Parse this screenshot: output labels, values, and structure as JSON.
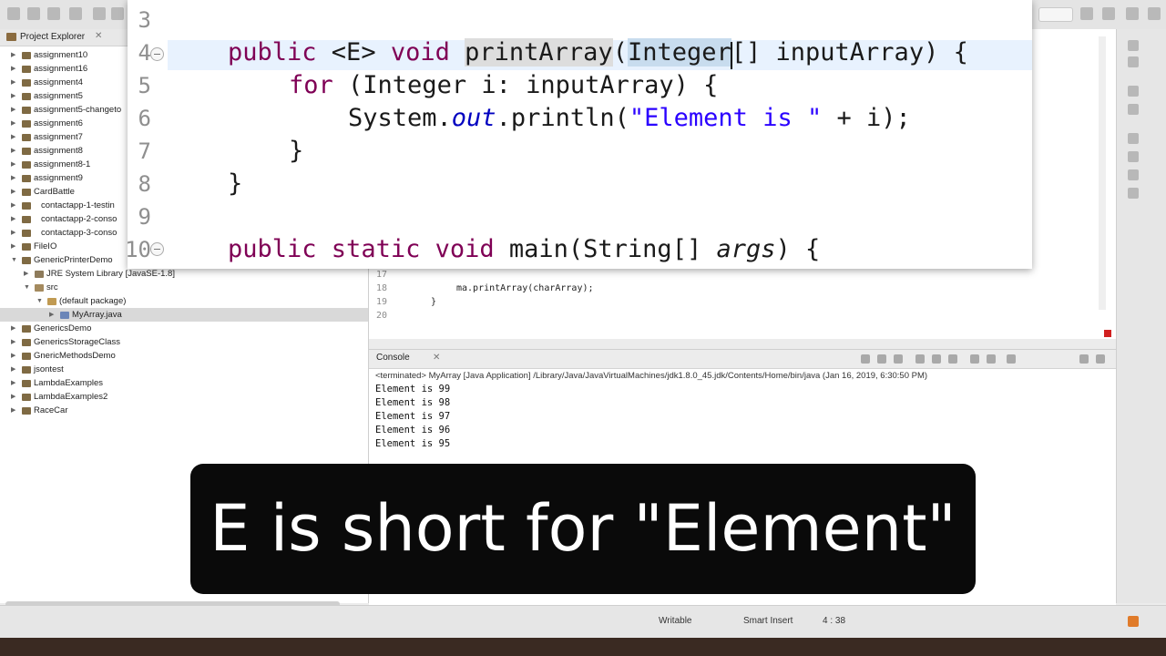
{
  "explorer": {
    "title": "Project Explorer",
    "close": "✕",
    "items": [
      {
        "label": "assignment10"
      },
      {
        "label": "assignment16"
      },
      {
        "label": "assignment4"
      },
      {
        "label": "assignment5"
      },
      {
        "label": "assignment5-changeto"
      },
      {
        "label": "assignment6"
      },
      {
        "label": "assignment7"
      },
      {
        "label": "assignment8"
      },
      {
        "label": "assignment8-1"
      },
      {
        "label": "assignment9"
      },
      {
        "label": "CardBattle"
      },
      {
        "label": "contactapp-1-testin"
      },
      {
        "label": "contactapp-2-conso"
      },
      {
        "label": "contactapp-3-conso"
      },
      {
        "label": "FileIO"
      },
      {
        "label": "GenericPrinterDemo"
      },
      {
        "label": "JRE System Library [JavaSE-1.8]"
      },
      {
        "label": "src"
      },
      {
        "label": "(default package)"
      },
      {
        "label": "MyArray.java"
      },
      {
        "label": "GenericsDemo"
      },
      {
        "label": "GenericsStorageClass"
      },
      {
        "label": "GnericMethodsDemo"
      },
      {
        "label": "jsontest"
      },
      {
        "label": "LambdaExamples"
      },
      {
        "label": "LambdaExamples2"
      },
      {
        "label": "RaceCar"
      }
    ]
  },
  "editor": {
    "lines": [
      {
        "num": "17",
        "code": ""
      },
      {
        "num": "18",
        "code": "ma.printArray(charArray);"
      },
      {
        "num": "19",
        "code": "}"
      },
      {
        "num": "20",
        "code": ""
      }
    ]
  },
  "zoom": {
    "line_numbers": [
      "3",
      "4",
      "5",
      "6",
      "7",
      "8",
      "9",
      "10"
    ],
    "line4": {
      "kw_public": "public",
      "generic": " <E> ",
      "kw_void": "void",
      "space": " ",
      "method": "printArray",
      "open": "(",
      "type": "Integer",
      "rest": "[] inputArray) {"
    },
    "line5": {
      "kw_for": "for",
      "rest": " (Integer i: inputArray) {"
    },
    "line6": {
      "sys": "System.",
      "out": "out",
      "call": ".println(",
      "str": "\"Element is \"",
      "rest": " + i);"
    },
    "line7": "}",
    "line8": "}",
    "line10": {
      "kw_public": "public",
      "kw_static": " static",
      "kw_void": " void",
      "main": " main(String[] ",
      "args": "args",
      "rest": ") {"
    }
  },
  "console": {
    "tab_label": "Console",
    "close": "✕",
    "terminated": "<terminated> MyArray [Java Application] /Library/Java/JavaVirtualMachines/jdk1.8.0_45.jdk/Contents/Home/bin/java (Jan 16, 2019, 6:30:50 PM)",
    "output": [
      "Element is 99",
      "Element is 98",
      "Element is 97",
      "Element is 96",
      "Element is 95"
    ]
  },
  "status": {
    "writable": "Writable",
    "insert_mode": "Smart Insert",
    "position": "4 : 38"
  },
  "caption": {
    "text": "E is short for \"Element\""
  },
  "colors": {
    "keyword": "#7f0055",
    "string": "#2a00ff",
    "field": "#0000c0",
    "caption_bg": "#0a0a0a"
  }
}
